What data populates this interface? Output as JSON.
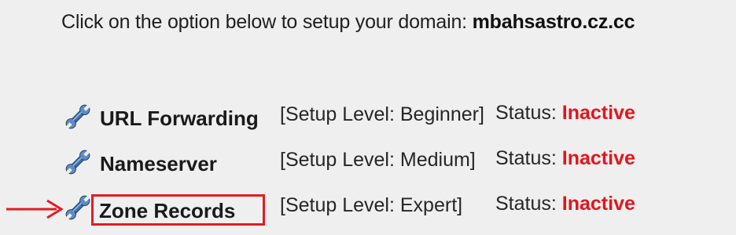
{
  "intro": {
    "text": "Click on the option below to setup your domain:",
    "domain": "mbahsastro.cz.cc"
  },
  "options": [
    {
      "icon": "wrench-icon",
      "name": "URL Forwarding",
      "setup_level": "[Setup Level: Beginner]",
      "status_label": "Status:",
      "status_value": "Inactive"
    },
    {
      "icon": "wrench-icon",
      "name": "Nameserver",
      "setup_level": "[Setup Level: Medium]",
      "status_label": "Status:",
      "status_value": "Inactive"
    },
    {
      "icon": "wrench-icon",
      "name": "Zone Records",
      "setup_level": "[Setup Level: Expert]",
      "status_label": "Status:",
      "status_value": "Inactive"
    }
  ],
  "annotation": {
    "highlight_color": "#e31b23",
    "arrow_icon": "red-arrow-icon"
  },
  "colors": {
    "status_inactive": "#e4141c",
    "icon_blue": "#3d6fa8"
  }
}
